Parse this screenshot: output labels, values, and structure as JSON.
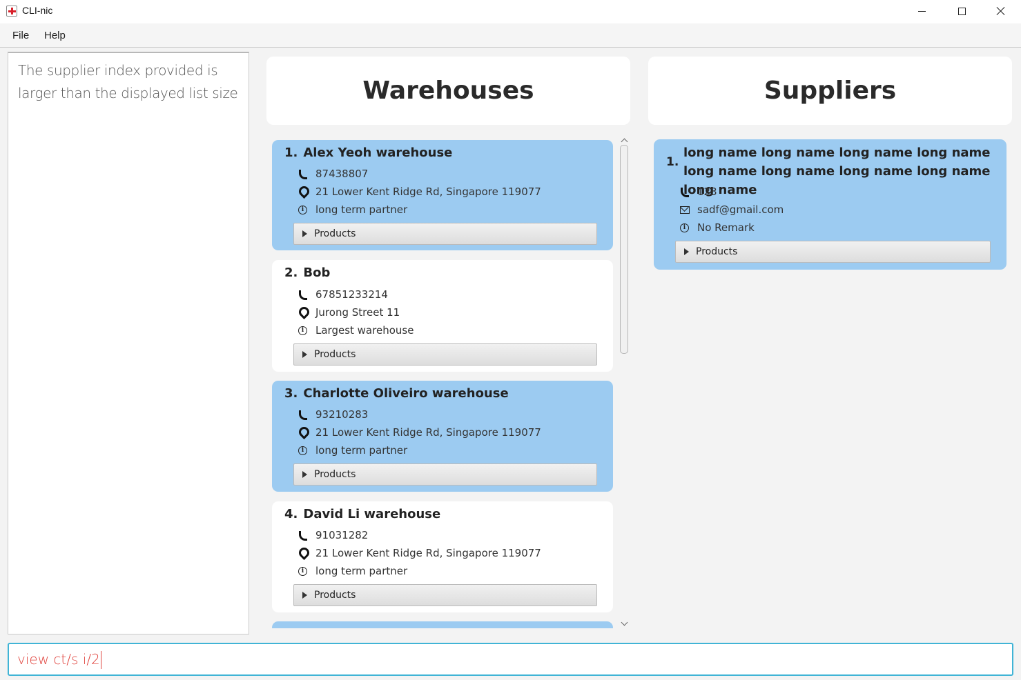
{
  "window": {
    "title": "CLI-nic"
  },
  "menu": {
    "file": "File",
    "help": "Help"
  },
  "result": {
    "text": "The supplier index provided is larger than the displayed list size"
  },
  "warehouses": {
    "title": "Warehouses",
    "items": [
      {
        "index": "1.",
        "name": "Alex Yeoh warehouse",
        "phone": "87438807",
        "address": "21 Lower Kent Ridge Rd, Singapore 119077",
        "remark": "long term partner",
        "products": "Products"
      },
      {
        "index": "2.",
        "name": "Bob",
        "phone": "67851233214",
        "address": "Jurong Street 11",
        "remark": "Largest warehouse",
        "products": "Products"
      },
      {
        "index": "3.",
        "name": "Charlotte Oliveiro warehouse",
        "phone": "93210283",
        "address": "21 Lower Kent Ridge Rd, Singapore 119077",
        "remark": "long term partner",
        "products": "Products"
      },
      {
        "index": "4.",
        "name": "David Li warehouse",
        "phone": "91031282",
        "address": "21 Lower Kent Ridge Rd, Singapore 119077",
        "remark": "long term partner",
        "products": "Products"
      }
    ]
  },
  "suppliers": {
    "title": "Suppliers",
    "items": [
      {
        "index": "1.",
        "name": "long name long name long name long name long name long name long name long name long name",
        "phone": "123",
        "email": "sadf@gmail.com",
        "remark": "No Remark",
        "products": "Products"
      }
    ]
  },
  "command": {
    "value": "view ct/s i/2"
  },
  "colors": {
    "selected_card": "#9ccbf1",
    "command_text": "#e0443e",
    "command_border": "#40b4d6"
  }
}
